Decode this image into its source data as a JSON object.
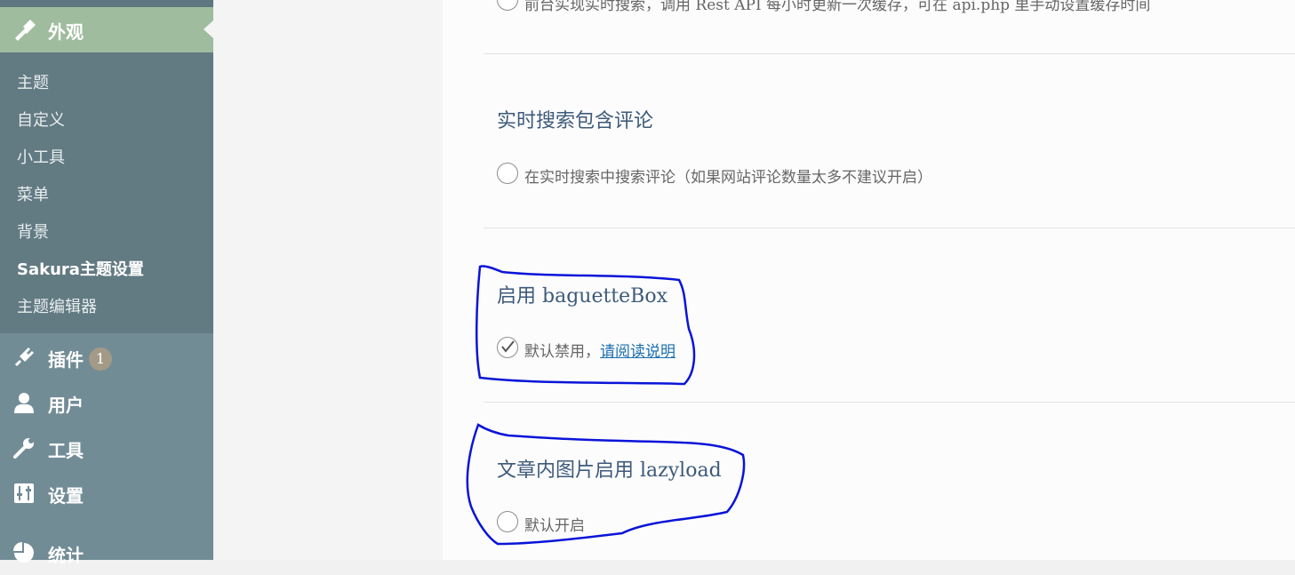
{
  "sidebar": {
    "appearance_label": "外观",
    "submenu": [
      "主题",
      "自定义",
      "小工具",
      "菜单",
      "背景",
      "Sakura主题设置",
      "主题编辑器"
    ],
    "plugins_label": "插件",
    "plugins_badge": "1",
    "users_label": "用户",
    "tools_label": "工具",
    "settings_label": "设置",
    "stats_label": "统计"
  },
  "options": {
    "top_partial_text": "前台实现实时搜索，调用 Rest API 每小时更新一次缓存，可在 api.php 里手动设置缓存时间",
    "live_search_comments": {
      "title": "实时搜索包含评论",
      "text": "在实时搜索中搜索评论（如果网站评论数量太多不建议开启）",
      "checked": false
    },
    "baguettebox": {
      "title": "启用 baguetteBox",
      "text": "默认禁用，",
      "link_text": "请阅读说明",
      "checked": true
    },
    "lazyload": {
      "title": "文章内图片启用 lazyload",
      "text": "默认开启",
      "checked": false
    }
  },
  "colors": {
    "sidebar_bg": "#728c96",
    "submenu_bg": "#627a82",
    "current_menu_bg": "#9fbc9e",
    "annotation_stroke": "#0a14d8"
  }
}
